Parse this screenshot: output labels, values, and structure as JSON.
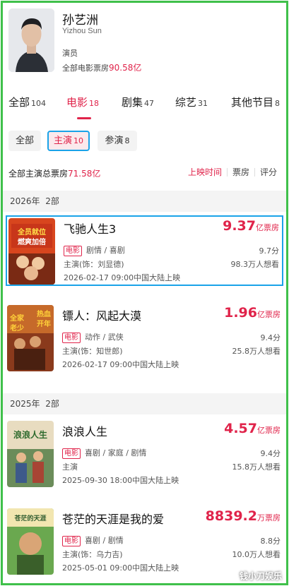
{
  "profile": {
    "name": "孙艺洲",
    "english_name": "Yizhou Sun",
    "role": "演员",
    "box_label": "全部电影票房",
    "box_value": "90.58亿"
  },
  "tabs": [
    {
      "label": "全部",
      "count": "104"
    },
    {
      "label": "电影",
      "count": "18"
    },
    {
      "label": "剧集",
      "count": "47"
    },
    {
      "label": "综艺",
      "count": "31"
    },
    {
      "label": "其他节目",
      "count": "8"
    }
  ],
  "subtabs": [
    {
      "label": "全部",
      "count": ""
    },
    {
      "label": "主演",
      "count": "10"
    },
    {
      "label": "参演",
      "count": "8"
    }
  ],
  "summary": {
    "label": "全部主演总票房",
    "value": "71.58亿",
    "sort_options": [
      "上映时间",
      "票房",
      "评分"
    ]
  },
  "years": [
    {
      "year": "2026年",
      "count": "2部"
    },
    {
      "year": "2025年",
      "count": "2部"
    }
  ],
  "movies": [
    {
      "title": "飞驰人生3",
      "box_num": "9.37",
      "box_unit": "亿票房",
      "tag": "电影",
      "genres": "剧情 / 喜剧",
      "cast": "主演(饰：刘显德)",
      "date": "2026-02-17 09:00中国大陆上映",
      "score": "9.7分",
      "want": "98.3万人想看",
      "poster_text": "全员就位 燃爽加倍"
    },
    {
      "title": "镖人：风起大漠",
      "box_num": "1.96",
      "box_unit": "亿票房",
      "tag": "电影",
      "genres": "动作 / 武侠",
      "cast": "主演(饰：知世郎)",
      "date": "2026-02-17 09:00中国大陆上映",
      "score": "9.4分",
      "want": "25.8万人想看",
      "poster_text": "热血开年 全家老少"
    },
    {
      "title": "浪浪人生",
      "box_num": "4.57",
      "box_unit": "亿票房",
      "tag": "电影",
      "genres": "喜剧 / 家庭 / 剧情",
      "cast": "主演",
      "date": "2025-09-30 18:00中国大陆上映",
      "score": "9.4分",
      "want": "15.8万人想看",
      "poster_text": "浪浪人生"
    },
    {
      "title": "苍茫的天涯是我的爱",
      "box_num": "8839.2",
      "box_unit": "万票房",
      "tag": "电影",
      "genres": "喜剧 / 剧情",
      "cast": "主演(饰：乌力吉)",
      "date": "2025-05-01 09:00中国大陆上映",
      "score": "8.8分",
      "want": "10.0万人想看",
      "poster_text": "苍茫的天涯是我的爱"
    }
  ],
  "watermark": "钱小刀娱乐",
  "colors": {
    "accent": "#e0234a",
    "highlight_border": "#1aa3e8",
    "frame": "#3fc04a"
  }
}
